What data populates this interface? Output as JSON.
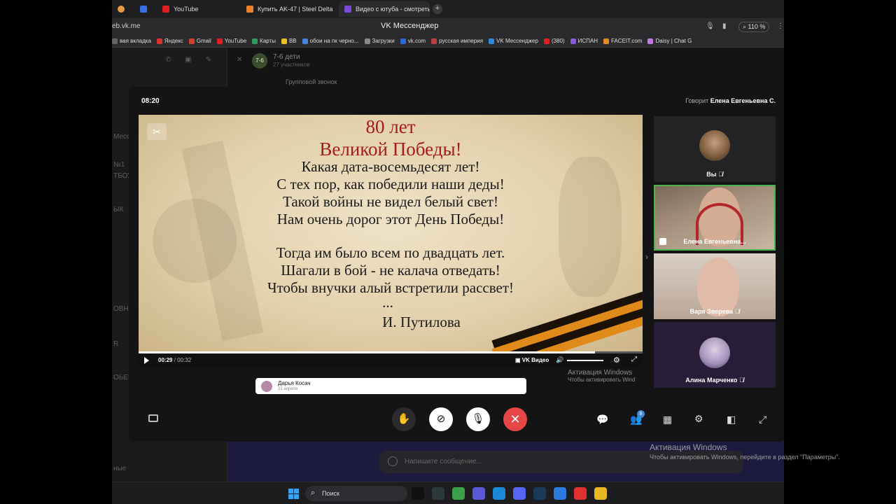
{
  "browser": {
    "tabs": [
      {
        "label": "",
        "color": "#e89b3a"
      },
      {
        "label": "",
        "color": "#3a6ee8"
      },
      {
        "label": "YouTube",
        "color": "#e02020"
      },
      {
        "label": "Купить AK-47 | Steel Delta",
        "color": "#e8832a"
      },
      {
        "label": "Видео с ютуба - смотреть",
        "color": "#7a4ad8"
      }
    ],
    "new_tab": "+",
    "url": "eb.vk.me",
    "page_title": "VK Мессенджер",
    "zoom": "110 %",
    "bookmarks": [
      {
        "label": "вая вкладка",
        "color": "#666666"
      },
      {
        "label": "Яндекс",
        "color": "#e03030"
      },
      {
        "label": "Gmail",
        "color": "#d04030"
      },
      {
        "label": "YouTube",
        "color": "#e02020"
      },
      {
        "label": "Карты",
        "color": "#2a9d5a"
      },
      {
        "label": "BB",
        "color": "#e8c020"
      },
      {
        "label": "обои на пк черно...",
        "color": "#4a80e0"
      },
      {
        "label": "Загрузки",
        "color": "#888888"
      },
      {
        "label": "vk.com",
        "color": "#2a6ad8"
      },
      {
        "label": "русская империя",
        "color": "#c04040"
      },
      {
        "label": "VK Мессенджер",
        "color": "#2a8ae0"
      },
      {
        "label": "(380)",
        "color": "#e02020"
      },
      {
        "label": "ИСПАН",
        "color": "#8a5ad8"
      },
      {
        "label": "FACEIT.com",
        "color": "#e88a20"
      },
      {
        "label": "Daisy | Chat G",
        "color": "#c07ae0"
      }
    ]
  },
  "vk": {
    "chat_title": "7-6 дети",
    "chat_subtitle": "27 участников",
    "chat_avatar": "7-6",
    "group_call": "Групповой звонок",
    "side_texts": [
      "Месс",
      "№1",
      "ТБОУ",
      "ЫК",
      "ОВНА",
      "R",
      "ОЬЕВ",
      "ные"
    ],
    "message_placeholder": "Напишите сообщение..."
  },
  "call": {
    "time": "08:20",
    "speaking_prefix": "Говорит",
    "speaking_name": "Елена Евгеньевна С.",
    "video": {
      "title_line1": "80 лет",
      "title_line2": "Великой Победы!",
      "poem": [
        "Какая дата-восемьдесят лет!",
        "С тех пор, как победили наши деды!",
        "Такой войны не видел белый свет!",
        "Нам очень дорог этот День Победы!",
        "",
        "Тогда им было всем по двадцать лет.",
        "Шагали в бой - не калача отведать!",
        "Чтобы внучки алый встретили рассвет!",
        "...",
        "И. Путилова"
      ],
      "current_time": "00:29",
      "duration": "00:32",
      "progress": 0.906,
      "brand": "VK Видео"
    },
    "participants": [
      {
        "name": "Вы",
        "type": "avatar",
        "avatar_color": "#7a5a3a",
        "active": false
      },
      {
        "name": "Елена Евгеньевна...",
        "type": "camera",
        "active": true
      },
      {
        "name": "Варя Зверева",
        "type": "camera2",
        "active": false
      },
      {
        "name": "Алина Марченко",
        "type": "avatar",
        "avatar_color": "#b0a0c8",
        "active": false
      }
    ],
    "notification": {
      "name": "Дарья Косач",
      "date": "21 апреля"
    },
    "participants_badge": "8",
    "inner_activation_1": "Активация Windows",
    "inner_activation_2": "Чтобы активировать Wind"
  },
  "windows_activation": {
    "title": "Активация Windows",
    "subtitle": "Чтобы активировать Windows, перейдите в раздел \"Параметры\"."
  },
  "taskbar": {
    "search_label": "Поиск",
    "apps": [
      {
        "name": "tiktok",
        "color": "#111111"
      },
      {
        "name": "terminal",
        "color": "#2a3a3a"
      },
      {
        "name": "chrome",
        "color": "#3aa04a"
      },
      {
        "name": "teams",
        "color": "#5a5ad8"
      },
      {
        "name": "edge",
        "color": "#1a8ad8"
      },
      {
        "name": "discord",
        "color": "#5865f2"
      },
      {
        "name": "steam",
        "color": "#1a3a5a"
      },
      {
        "name": "vk",
        "color": "#2a7ae0"
      },
      {
        "name": "yandex",
        "color": "#e03030"
      },
      {
        "name": "explorer",
        "color": "#e8b820"
      }
    ]
  }
}
